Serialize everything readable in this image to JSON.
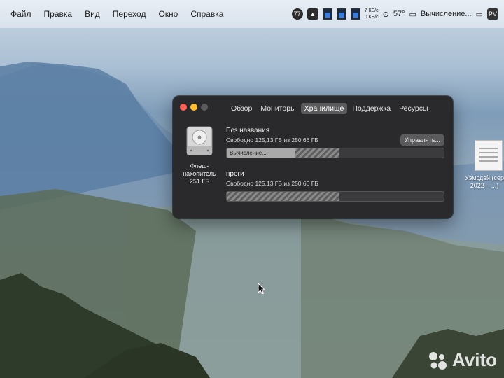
{
  "menubar": {
    "items": [
      "Файл",
      "Правка",
      "Вид",
      "Переход",
      "Окно",
      "Справка"
    ],
    "status": {
      "net_up": "7 КБ/с",
      "net_down": "0 КБ/с",
      "temperature": "57°",
      "battery_label": "Вычисление...",
      "user_badge": "PV",
      "badge_a": "77"
    }
  },
  "window": {
    "tabs": [
      "Обзор",
      "Мониторы",
      "Хранилище",
      "Поддержка",
      "Ресурсы"
    ],
    "active_tab": "Хранилище",
    "drive_caption_line1": "Флеш-",
    "drive_caption_line2": "накопитель",
    "drive_caption_line3": "251 ГБ",
    "volumes": [
      {
        "name": "Без названия",
        "free": "Свободно 125,13 ГБ из 250,66 ГБ",
        "bar_label": "Вычисление...",
        "used_fraction": 0.5
      },
      {
        "name": "проги",
        "free": "Свободно 125,13 ГБ из 250,66 ГБ",
        "bar_label": "",
        "used_fraction": 0.5
      }
    ],
    "manage_label": "Управлять..."
  },
  "desktop": {
    "file_label": "Уэмсдэй (сери",
    "file_label2": "2022 – ...)"
  },
  "watermark": "Avito"
}
